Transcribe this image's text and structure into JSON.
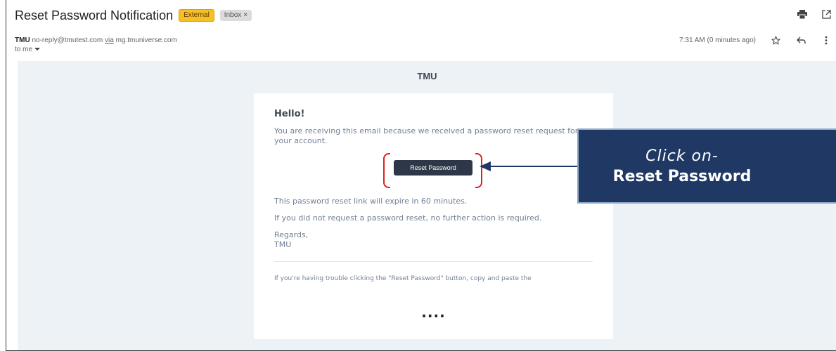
{
  "email": {
    "subject": "Reset Password Notification",
    "labels": {
      "external": "External",
      "inbox": "Inbox",
      "inbox_remove": "×"
    },
    "sender": {
      "name": "TMU",
      "address": "no-reply@tmutest.com",
      "via_label": "via",
      "via_domain": "mg.tmuniverse.com"
    },
    "recipient": "to me",
    "time": "7:31 AM (0 minutes ago)",
    "icons": [
      "print-icon",
      "open-in-new-window-icon",
      "star-icon",
      "reply-icon",
      "more-options-icon",
      "chevron-down-icon"
    ]
  },
  "body": {
    "brand": "TMU",
    "greeting": "Hello!",
    "intro": "You are receiving this email because we received a password reset request for your account.",
    "button_label": "Reset Password",
    "expiry": "This password reset link will expire in 60 minutes.",
    "no_action": "If you did not request a password reset, no further action is required.",
    "regards": "Regards,",
    "signature": "TMU",
    "trouble": "If you're having trouble clicking the \"Reset Password\" button, copy and paste the",
    "ellipsis": "...."
  },
  "annotation": {
    "line1": "Click on-",
    "line2": "Reset Password",
    "callout_color": "#1f3864",
    "bracket_color": "#e02020"
  }
}
